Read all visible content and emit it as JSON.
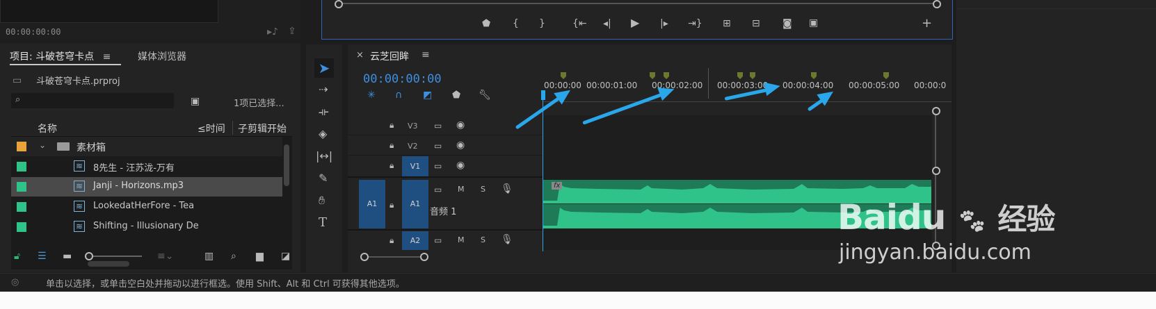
{
  "source_monitor": {
    "timecode": "00:00:00:00"
  },
  "project": {
    "tab_label": "项目: 斗破苍穹卡点",
    "tab_media_browser": "媒体浏览器",
    "filename": "斗破苍穹卡点.prproj",
    "selection_status": "1项已选择...",
    "columns": {
      "name": "名称",
      "col2": "≤时间",
      "col3": "子剪辑开始"
    },
    "folder_name": "素材箱",
    "items": [
      {
        "name": "8先生 - 汪苏泷-万有",
        "color": "#2fc38a"
      },
      {
        "name": "Janji - Horizons.mp3",
        "color": "#2fc38a"
      },
      {
        "name": "LookedatHerFore - Tea",
        "color": "#2fc38a"
      },
      {
        "name": "Shifting - Illusionary De",
        "color": "#2fc38a"
      }
    ],
    "folder_color": "#e8a33a"
  },
  "timeline": {
    "close_label": "×",
    "sequence_name": "云芝回眸",
    "timecode": "00:00:00:00",
    "ruler": [
      "00:00:00",
      "00:00:01:00",
      "00:00:02:00",
      "00:00:03:00",
      "00:00:04:00",
      "00:00:05:00",
      "00:00:0"
    ],
    "tracks": {
      "v3": "V3",
      "v2": "V2",
      "v1": "V1",
      "a1_left": "A1",
      "a1": "A1",
      "a1_name": "音频 1",
      "a2": "A2",
      "m": "M",
      "s": "S"
    },
    "fx_label": "fx",
    "playhead_color": "#2aa6ea",
    "audio_clip_color": "#2fc38a"
  },
  "statusbar": {
    "text": "单击以选择，或单击空白处并拖动以进行框选。使用 Shift、Alt 和 Ctrl 可获得其他选项。"
  },
  "watermark": {
    "brand": "Baidu",
    "sub": "经验",
    "url": "jingyan.baidu.com"
  }
}
